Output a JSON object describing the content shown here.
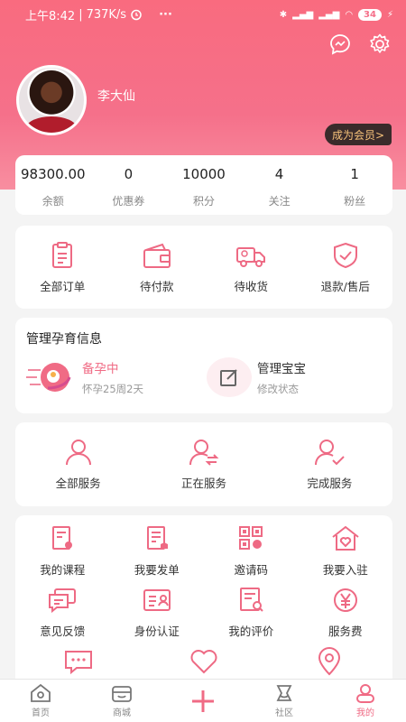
{
  "status_bar": {
    "time": "上午8:42",
    "speed": "737K/s",
    "alarm": "alarm-icon",
    "more": "···",
    "battery": "34"
  },
  "user": {
    "name": "李大仙",
    "member_button": "成为会员>"
  },
  "stats": [
    {
      "value": "98300.00",
      "label": "余额"
    },
    {
      "value": "0",
      "label": "优惠券"
    },
    {
      "value": "10000",
      "label": "积分"
    },
    {
      "value": "4",
      "label": "关注"
    },
    {
      "value": "1",
      "label": "粉丝"
    }
  ],
  "orders": [
    {
      "label": "全部订单",
      "icon": "clipboard-icon"
    },
    {
      "label": "待付款",
      "icon": "wallet-icon"
    },
    {
      "label": "待收货",
      "icon": "truck-icon"
    },
    {
      "label": "退款/售后",
      "icon": "shield-check-icon"
    }
  ],
  "pregnancy": {
    "title": "管理孕育信息",
    "status_title": "备孕中",
    "status_sub": "怀孕25周2天",
    "baby_title": "管理宝宝",
    "baby_sub": "修改状态"
  },
  "services": [
    {
      "label": "全部服务",
      "icon": "person-icon"
    },
    {
      "label": "正在服务",
      "icon": "person-exchange-icon"
    },
    {
      "label": "完成服务",
      "icon": "person-check-icon"
    }
  ],
  "tools": [
    {
      "label": "我的课程",
      "icon": "course-icon"
    },
    {
      "label": "我要发单",
      "icon": "post-order-icon"
    },
    {
      "label": "邀请码",
      "icon": "qr-code-icon"
    },
    {
      "label": "我要入驻",
      "icon": "home-heart-icon"
    },
    {
      "label": "意见反馈",
      "icon": "feedback-icon"
    },
    {
      "label": "身份认证",
      "icon": "id-card-icon"
    },
    {
      "label": "我的评价",
      "icon": "review-icon"
    },
    {
      "label": "服务费",
      "icon": "yen-icon"
    }
  ],
  "tabs": [
    {
      "label": "首页",
      "icon": "home-icon"
    },
    {
      "label": "商城",
      "icon": "shop-icon"
    },
    {
      "label": "",
      "icon": "plus-icon"
    },
    {
      "label": "社区",
      "icon": "community-icon"
    },
    {
      "label": "我的",
      "icon": "user-icon"
    }
  ],
  "colors": {
    "accent": "#f06b85",
    "header": "#f96b7f",
    "member_bg": "#3a2b2b",
    "member_text": "#f6c27a"
  }
}
